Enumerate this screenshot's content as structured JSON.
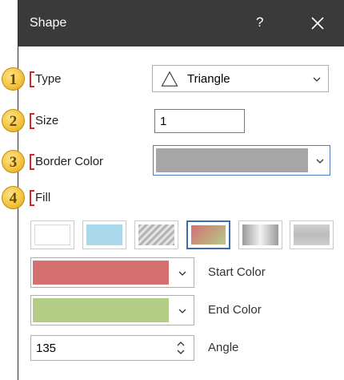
{
  "window": {
    "title": "Shape",
    "help_label": "?"
  },
  "steps": [
    {
      "number": "1",
      "label": "Type"
    },
    {
      "number": "2",
      "label": "Size"
    },
    {
      "number": "3",
      "label": "Border Color"
    },
    {
      "number": "4",
      "label": "Fill"
    }
  ],
  "type_select": {
    "value": "Triangle",
    "icon": "triangle-outline-icon"
  },
  "size_input": {
    "value": "1"
  },
  "border_color": {
    "color": "#a6a6a6"
  },
  "fill_options": [
    {
      "name": "none",
      "selected": false
    },
    {
      "name": "solid",
      "selected": false
    },
    {
      "name": "pattern",
      "selected": false
    },
    {
      "name": "gradient",
      "selected": true
    },
    {
      "name": "shaded",
      "selected": false
    },
    {
      "name": "texture",
      "selected": false
    }
  ],
  "start_color": {
    "label": "Start Color",
    "color": "#d47070"
  },
  "end_color": {
    "label": "End Color",
    "color": "#b3cd87"
  },
  "angle": {
    "label": "Angle",
    "value": "135"
  },
  "colors": {
    "titlebar": "#3a3a3a",
    "badge": "#f4c542",
    "bracket": "#d2262a",
    "selected_border": "#3c6db0",
    "solid_swatch": "#a9d9ea"
  }
}
